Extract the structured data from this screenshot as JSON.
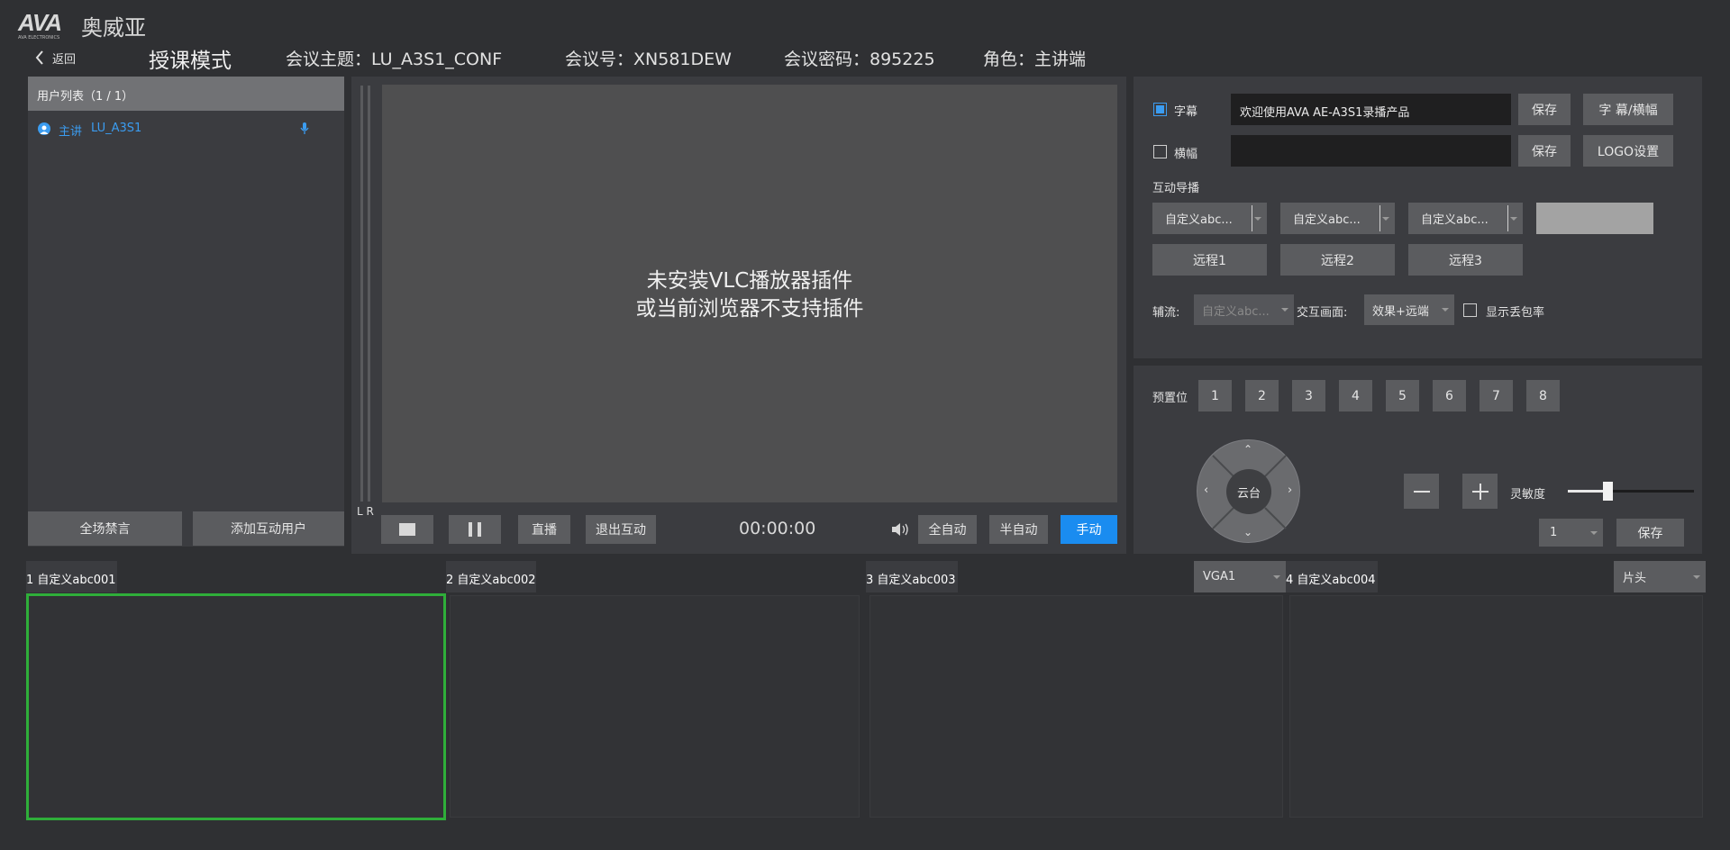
{
  "header": {
    "logo_mark": "AVA",
    "logo_sub": "AVA ELECTRONICS",
    "logo_cn": "奥威亚",
    "back_label": "返回",
    "mode": "授课模式",
    "conf_topic": "会议主题：LU_A3S1_CONF",
    "conf_no": "会议号：XN581DEW",
    "conf_pwd": "会议密码：895225",
    "role": "角色：主讲端"
  },
  "userlist": {
    "title": "用户列表（1 / 1）",
    "users": [
      {
        "role": "主讲",
        "name": "LU_A3S1"
      }
    ],
    "mute_all": "全场禁言",
    "add_user": "添加互动用户"
  },
  "video": {
    "message_line1": "未安装VLC播放器插件",
    "message_line2": "或当前浏览器不支持插件",
    "meter_label": "L R",
    "live": "直播",
    "exit_interactive": "退出互动",
    "time": "00:00:00",
    "full_auto": "全自动",
    "semi_auto": "半自动",
    "manual": "手动"
  },
  "settings": {
    "subtitle_label": "字幕",
    "subtitle_checked": true,
    "subtitle_value": "欢迎使用AVA AE-A3S1录播产品",
    "banner_label": "横幅",
    "banner_checked": false,
    "banner_value": "",
    "save": "保存",
    "subtitle_banner_btn": "字 幕/横幅",
    "logo_btn": "LOGO设置",
    "interactive_guide": "互动导播",
    "custom1": "自定义abc...",
    "custom2": "自定义abc...",
    "custom3": "自定义abc...",
    "remote1": "远程1",
    "remote2": "远程2",
    "remote3": "远程3",
    "aux_label": "辅流:",
    "aux_value": "自定义abc...",
    "interact_label": "交互画面:",
    "interact_value": "效果+远端",
    "packet_loss": "显示丢包率"
  },
  "ptz": {
    "preset_label": "预置位",
    "presets": [
      "1",
      "2",
      "3",
      "4",
      "5",
      "6",
      "7",
      "8"
    ],
    "center": "云台",
    "sensitivity": "灵敏度",
    "sensitivity_level": 0.3,
    "speed_value": "1",
    "save": "保存"
  },
  "bottom": {
    "cells": [
      {
        "label": "1 自定义abc001",
        "select": ""
      },
      {
        "label": "2 自定义abc002",
        "select": ""
      },
      {
        "label": "3 自定义abc003",
        "select": "VGA1"
      },
      {
        "label": "4 自定义abc004",
        "select": "片头"
      }
    ]
  },
  "colors": {
    "background": "#2f3033",
    "panel": "#3b3c40",
    "button": "#5b5c5f",
    "accent": "#1a8cf0",
    "selected_border": "#2fae3a"
  }
}
